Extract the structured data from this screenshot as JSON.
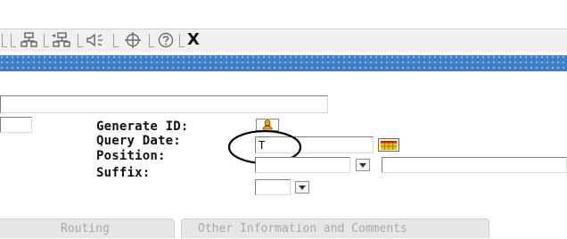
{
  "toolbar": {
    "icons": [
      "tree-split-icon",
      "tree-expand-icon",
      "speaker-icon",
      "crosshair-icon",
      "help-icon",
      "close-icon"
    ],
    "close_label": "X"
  },
  "form": {
    "generate_id_label": "Generate ID:",
    "query_date_label": "Query Date:",
    "query_date_value": "T",
    "position_label": "Position:",
    "suffix_label": "Suffix:"
  },
  "tabs": [
    {
      "label": "Routing"
    },
    {
      "label": "Other Information and Comments"
    }
  ],
  "colors": {
    "banner": "#3e7fc4",
    "toolbar": "#f0f0f0",
    "tab_text": "#a8a8a8",
    "annotation_circle": "#000000"
  }
}
